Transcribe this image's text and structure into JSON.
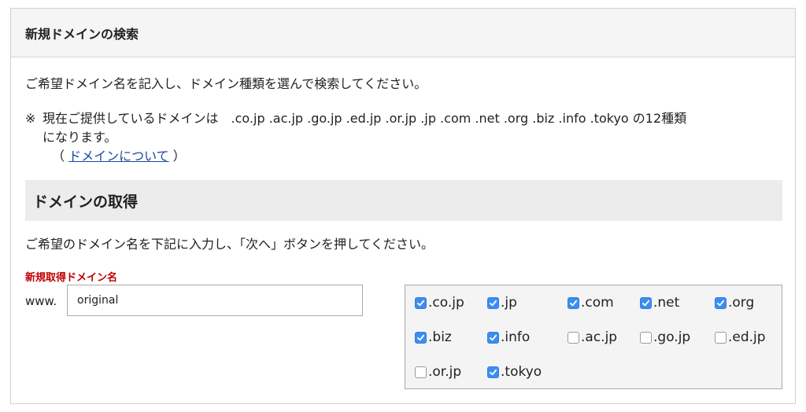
{
  "header": {
    "title": "新規ドメインの検索"
  },
  "intro": "ご希望ドメイン名を記入し、ドメイン種類を選んで検索してください。",
  "note": {
    "mark": "※",
    "line1": "現在ご提供しているドメインは　.co.jp .ac.jp .go.jp .ed.jp .or.jp .jp .com .net .org .biz .info .tokyo の12種類",
    "line2": "になります。",
    "paren_open": "（ ",
    "link": "ドメインについて",
    "paren_close": " ）"
  },
  "section": {
    "title": "ドメインの取得"
  },
  "instruction": "ご希望のドメイン名を下記に入力し、「次へ」ボタンを押してください。",
  "form": {
    "label": "新規取得ドメイン名",
    "prefix": "www.",
    "value": "original"
  },
  "domains": [
    {
      "label": ".co.jp",
      "checked": true
    },
    {
      "label": ".jp",
      "checked": true
    },
    {
      "label": ".com",
      "checked": true
    },
    {
      "label": ".net",
      "checked": true
    },
    {
      "label": ".org",
      "checked": true
    },
    {
      "label": ".biz",
      "checked": true
    },
    {
      "label": ".info",
      "checked": true
    },
    {
      "label": ".ac.jp",
      "checked": false
    },
    {
      "label": ".go.jp",
      "checked": false
    },
    {
      "label": ".ed.jp",
      "checked": false
    },
    {
      "label": ".or.jp",
      "checked": false
    },
    {
      "label": ".tokyo",
      "checked": true
    }
  ],
  "colors": {
    "accent": "#3b8ef0",
    "label_red": "#c00000",
    "link": "#1a4a9e"
  }
}
